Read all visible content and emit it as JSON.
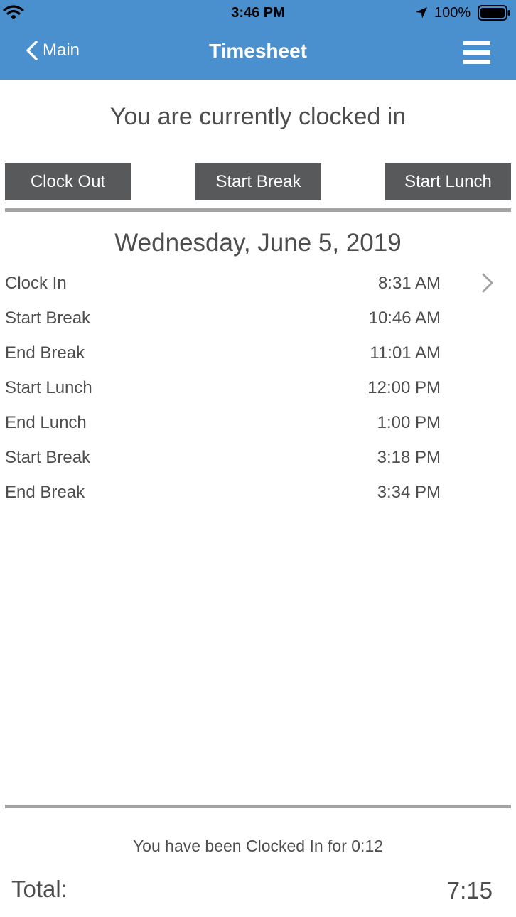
{
  "status_bar": {
    "time": "3:46 PM",
    "battery": "100%",
    "icons": [
      "wifi-icon",
      "location-icon",
      "battery-icon"
    ]
  },
  "nav": {
    "back_label": "Main",
    "title": "Timesheet",
    "menu_icon": "hamburger-menu-icon"
  },
  "status_message": "You are currently clocked in",
  "actions": {
    "clock_out": "Clock Out",
    "start_break": "Start Break",
    "start_lunch": "Start Lunch"
  },
  "date": "Wednesday, June 5, 2019",
  "entries": [
    {
      "label": "Clock In",
      "time": "8:31 AM"
    },
    {
      "label": "Start Break",
      "time": "10:46 AM"
    },
    {
      "label": "End Break",
      "time": "11:01 AM"
    },
    {
      "label": "Start Lunch",
      "time": "12:00 PM"
    },
    {
      "label": "End Lunch",
      "time": "1:00 PM"
    },
    {
      "label": "Start Break",
      "time": "3:18 PM"
    },
    {
      "label": "End Break",
      "time": "3:34 PM"
    }
  ],
  "footer": {
    "clocked_in_prefix": "You have been Clocked In for",
    "clocked_in_duration": "0:12",
    "total_label": "Total:",
    "total_value": "7:15"
  },
  "colors": {
    "header": "#4a90cf",
    "button": "#58595b",
    "divider": "#a3a3a6",
    "text": "#4d4d4d"
  }
}
